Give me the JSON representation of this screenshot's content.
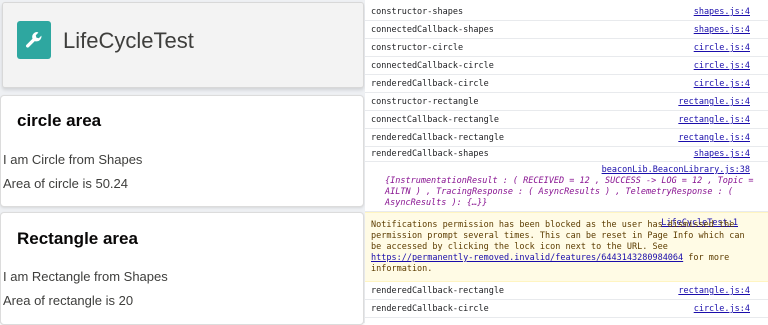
{
  "app": {
    "title": "LifeCycleTest",
    "icon": "wrench-icon",
    "icon_color": "#2ea7a0"
  },
  "cards": [
    {
      "title": "circle area",
      "lines": [
        "I am Circle from Shapes",
        "Area of circle is 50.24"
      ]
    },
    {
      "title": "Rectangle area",
      "lines": [
        "I am Rectangle from Shapes",
        "Area of rectangle is 20"
      ]
    }
  ],
  "console": {
    "rows": [
      {
        "msg": "constructor-shapes",
        "src": "shapes.js:4"
      },
      {
        "msg": "connectedCallback-shapes",
        "src": "shapes.js:4"
      },
      {
        "msg": "constructor-circle",
        "src": "circle.js:4"
      },
      {
        "msg": "connectedCallback-circle",
        "src": "circle.js:4"
      },
      {
        "msg": "renderedCallback-circle",
        "src": "circle.js:4"
      },
      {
        "msg": "constructor-rectangle",
        "src": "rectangle.js:4"
      },
      {
        "msg": "connectCallback-rectangle",
        "src": "rectangle.js:4"
      },
      {
        "msg": "renderedCallback-rectangle",
        "src": "rectangle.js:4"
      },
      {
        "msg": "renderedCallback-shapes",
        "src": "shapes.js:4"
      }
    ],
    "object_log": {
      "src": "beaconLib.BeaconLibrary.js:38",
      "text": "{InstrumentationResult : ( RECEIVED = 12 , SUCCESS -> LOG = 12 , Topic = AILTN ) , TracingResponse : ( AsyncResults ) , TelemetryResponse : ( AsyncResults ): {…}}"
    },
    "warning": {
      "icon": "warning-icon",
      "src": "LifeCycleTest:1",
      "text": "Notifications permission has been blocked as the user has dismissed the permission prompt several times. This can be reset in Page Info which can be accessed by clicking the lock icon next to the URL. See",
      "link": "https://permanently-removed.invalid/features/6443143280984064",
      "suffix": "for more information."
    },
    "tail_rows": [
      {
        "msg": "renderedCallback-rectangle",
        "src": "rectangle.js:4"
      },
      {
        "msg": "renderedCallback-circle",
        "src": "circle.js:4"
      }
    ]
  }
}
